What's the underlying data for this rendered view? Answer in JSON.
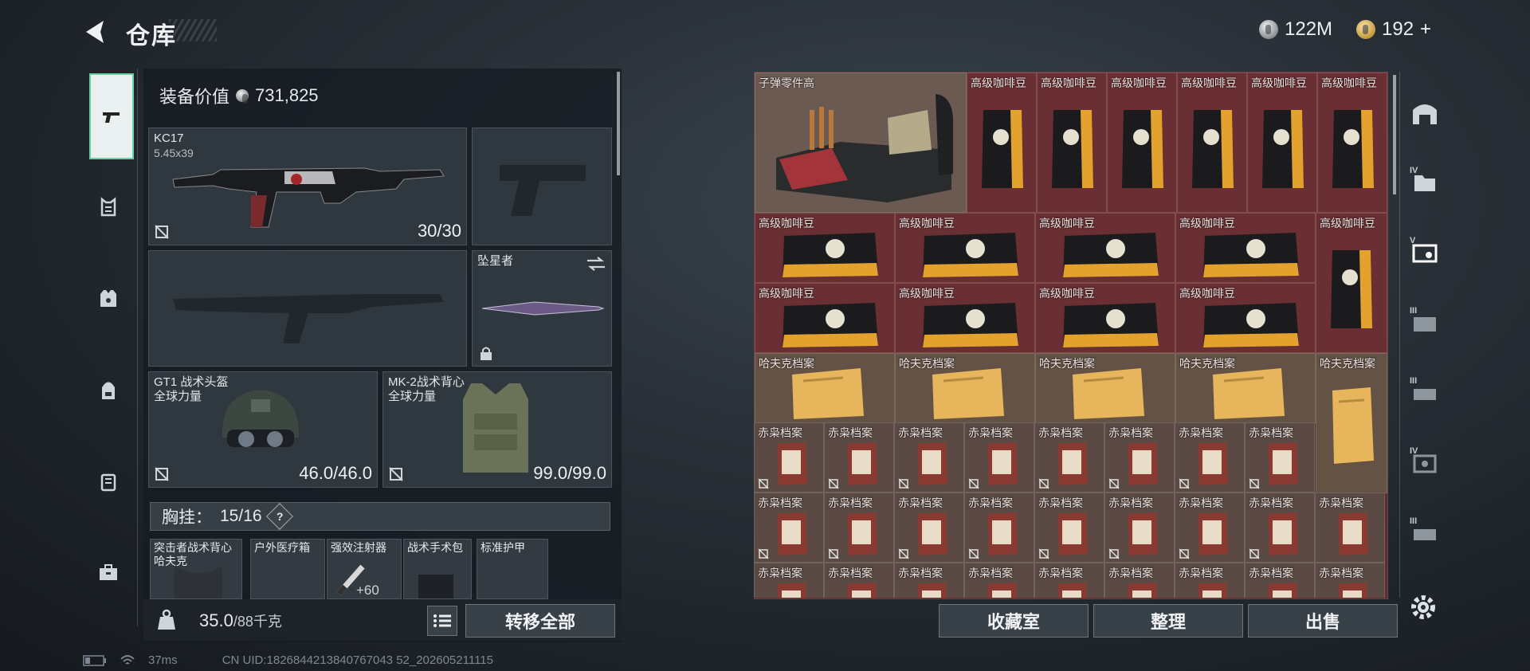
{
  "header": {
    "title": "仓库",
    "currency_silver": "122M",
    "currency_gold": "192",
    "currency_gold_suffix": "+"
  },
  "equipment": {
    "value_label": "装备价值",
    "value": "731,825",
    "primary": {
      "name": "KC17",
      "caliber": "5.45x39",
      "ammo": "30/30"
    },
    "melee": {
      "name": "坠星者"
    },
    "helmet": {
      "name": "GT1 战术头盔",
      "maker": "全球力量",
      "durability": "46.0/46.0"
    },
    "armor": {
      "name": "MK-2战术背心",
      "maker": "全球力量",
      "durability": "99.0/99.0"
    },
    "chest_rig": {
      "label": "胸挂：",
      "count": "15/16",
      "help": "?"
    },
    "pouches": [
      {
        "name": "突击者战术背心",
        "sub": "哈夫克"
      },
      {
        "name": "户外医疗箱"
      },
      {
        "name": "强效注射器",
        "count": "+60"
      },
      {
        "name": "战术手术包"
      },
      {
        "name": "标准护甲"
      }
    ],
    "weight": "35.0",
    "weight_max": "/88千克",
    "transfer_all": "转移全部"
  },
  "stash": {
    "ammo_item": "子弹零件高",
    "coffee": "高级咖啡豆",
    "havoc_file": "哈夫克档案",
    "red_file": "赤枭档案",
    "buttons": {
      "collection": "收藏室",
      "sort": "整理",
      "sell": "出售"
    }
  },
  "status_bar": {
    "ping": "37ms",
    "uid": "CN UID:1826844213840767043 52_202605211115"
  },
  "colors": {
    "accent": "#6bd0a0",
    "stash_bg": "#5c2d31"
  }
}
